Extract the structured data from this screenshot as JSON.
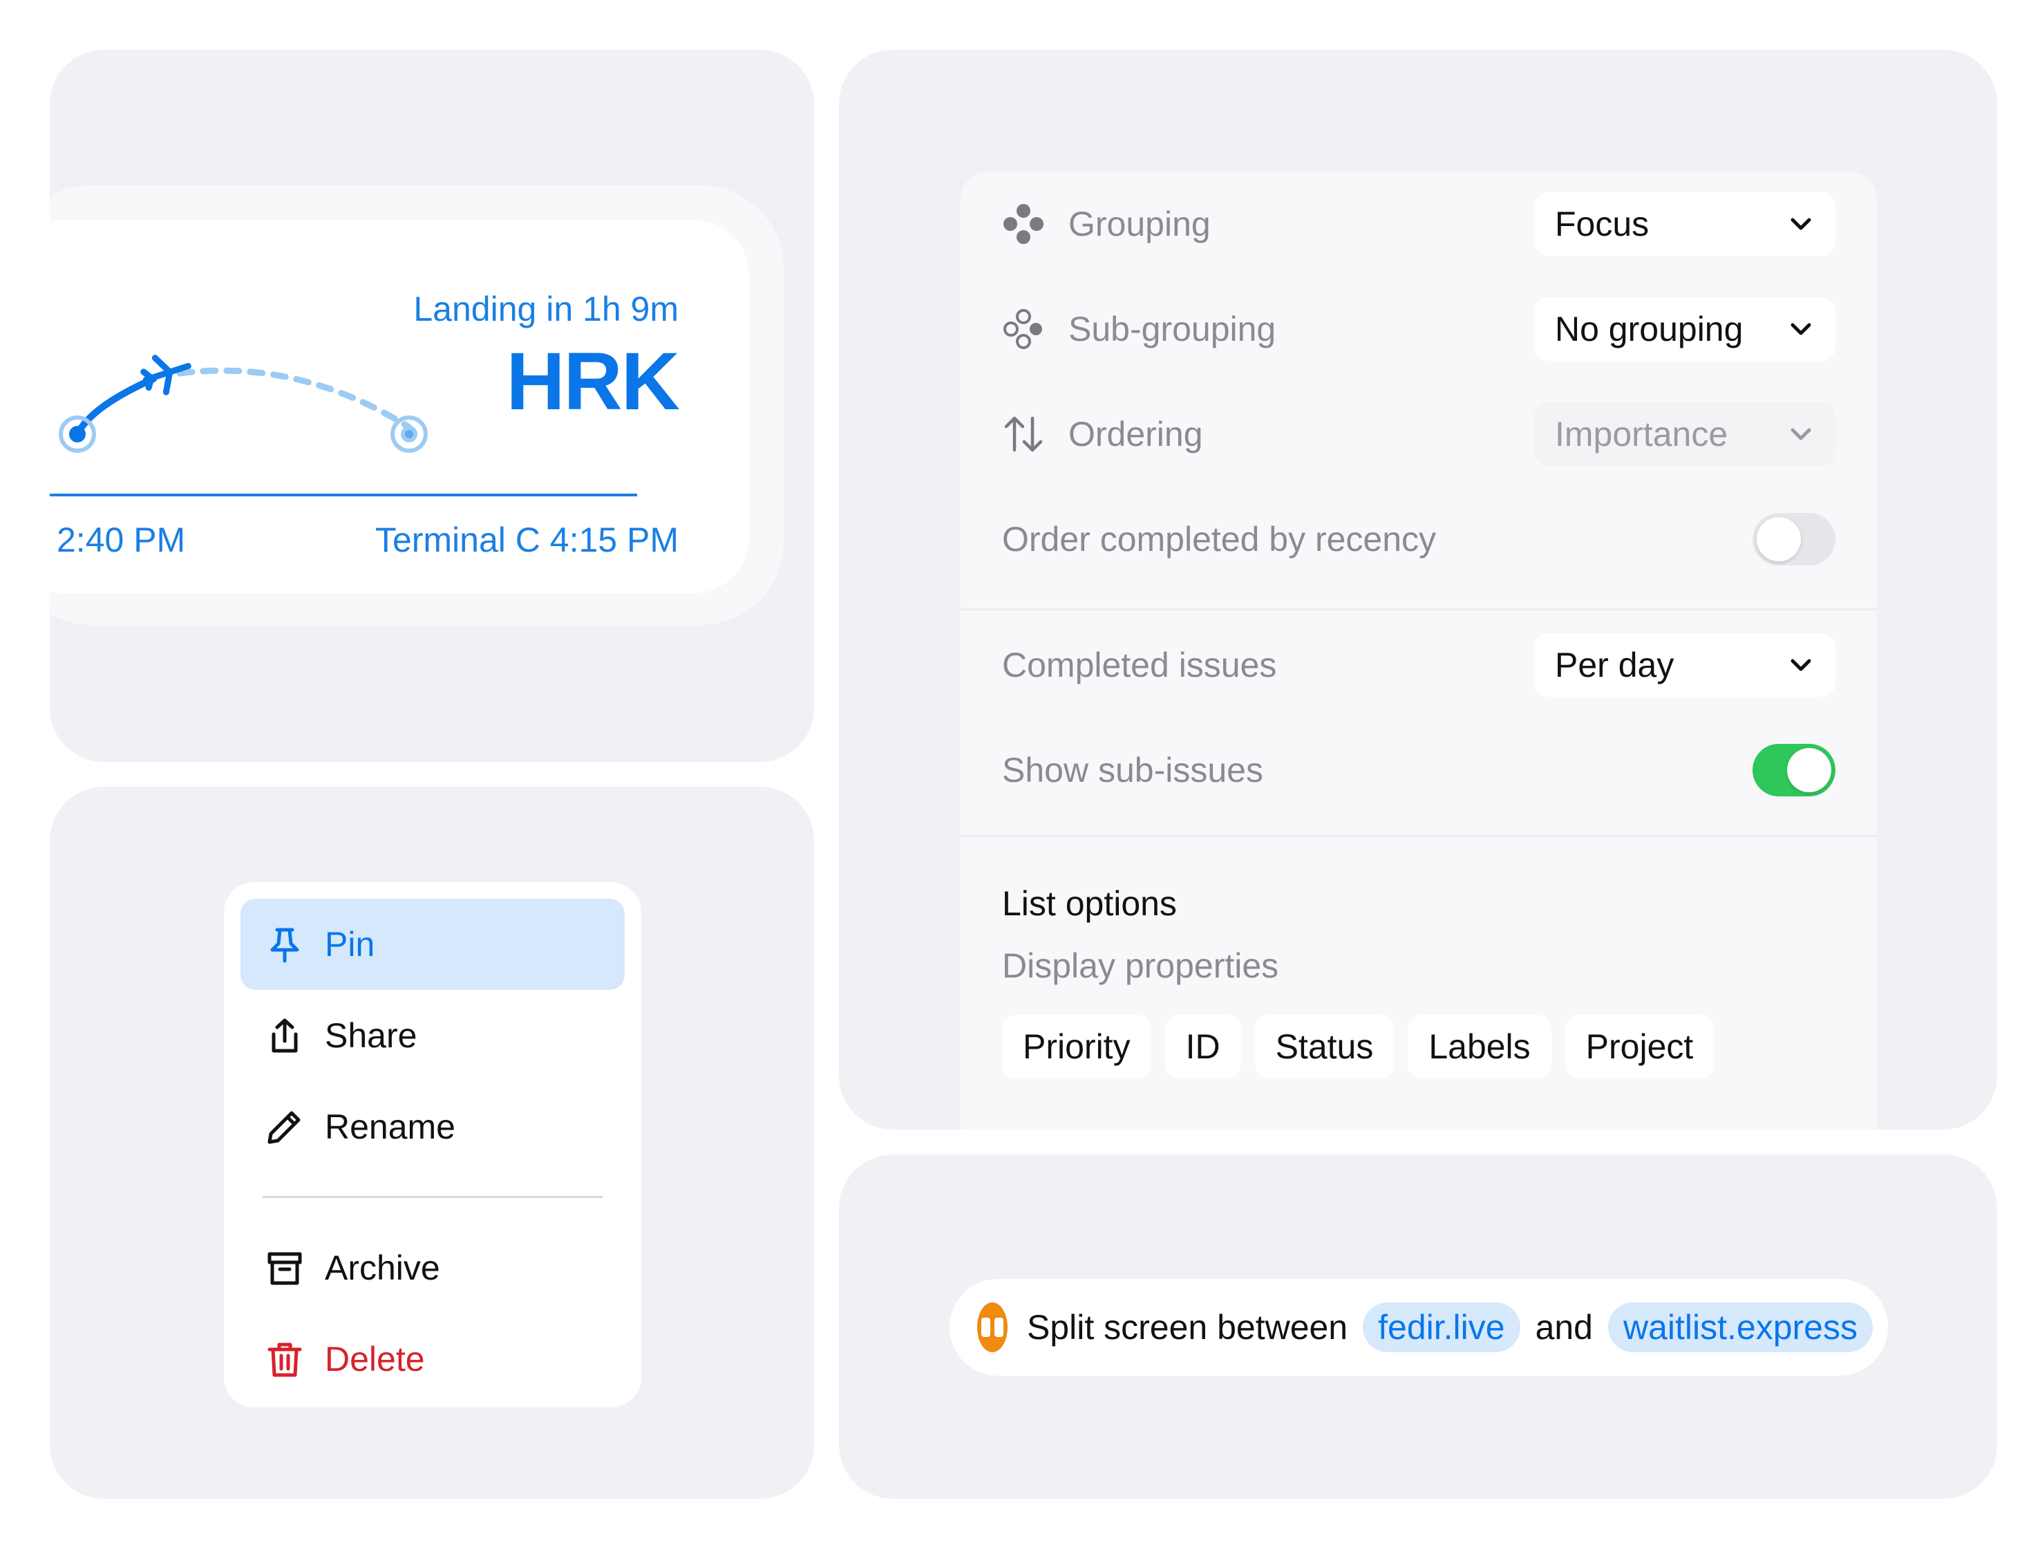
{
  "flight": {
    "landing_text": "Landing in 1h 9m",
    "destination_code": "HRK",
    "departure_time": "2:40 PM",
    "arrival_info": "Terminal C 4:15 PM",
    "accent_color": "#0a76e8"
  },
  "menu": {
    "items": [
      {
        "label": "Pin",
        "icon": "pin-icon",
        "state": "highlighted"
      },
      {
        "label": "Share",
        "icon": "share-icon"
      },
      {
        "label": "Rename",
        "icon": "pencil-icon"
      },
      {
        "label": "Archive",
        "icon": "archive-icon"
      },
      {
        "label": "Delete",
        "icon": "trash-icon",
        "state": "destructive"
      }
    ],
    "highlight_color": "#d6e8fb",
    "destructive_color": "#d6222a"
  },
  "settings": {
    "grouping": {
      "label": "Grouping",
      "value": "Focus",
      "icon": "grouping-icon"
    },
    "sub_grouping": {
      "label": "Sub-grouping",
      "value": "No grouping",
      "icon": "sub-grouping-icon"
    },
    "ordering": {
      "label": "Ordering",
      "value": "Importance",
      "icon": "sort-arrows-icon"
    },
    "order_completed": {
      "label": "Order completed by recency",
      "enabled": false
    },
    "completed_issues": {
      "label": "Completed issues",
      "value": "Per day"
    },
    "show_sub_issues": {
      "label": "Show sub-issues",
      "enabled": true
    },
    "list_options": {
      "title": "List options",
      "subtitle": "Display properties",
      "properties": [
        "Priority",
        "ID",
        "Status",
        "Labels",
        "Project"
      ]
    },
    "toggle_on_color": "#2fc65a"
  },
  "split": {
    "icon": "split-screen-icon",
    "text_before": "Split screen between",
    "site_a": "fedir.live",
    "conjunction": "and",
    "site_b": "waitlist.express",
    "icon_color": "#f08a10"
  }
}
